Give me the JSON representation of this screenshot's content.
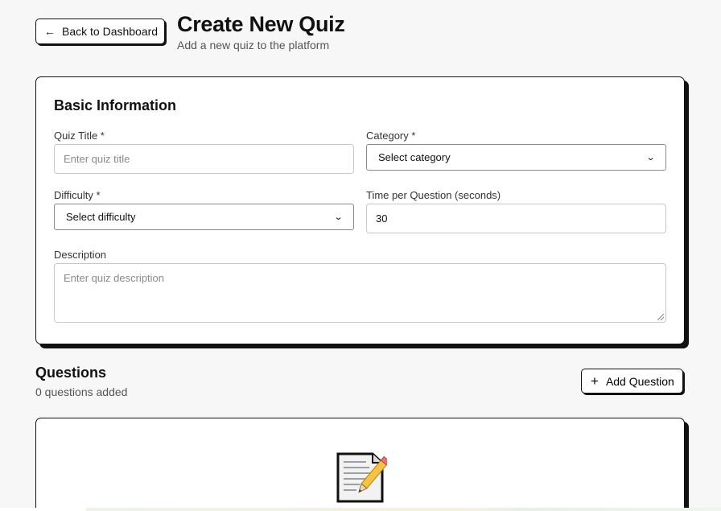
{
  "header": {
    "back_label": "Back to Dashboard",
    "title": "Create New Quiz",
    "subtitle": "Add a new quiz to the platform"
  },
  "basic_info": {
    "title": "Basic Information",
    "quiz_title": {
      "label": "Quiz Title *",
      "value": "",
      "placeholder": "Enter quiz title"
    },
    "category": {
      "label": "Category *",
      "selected": "Select category"
    },
    "difficulty": {
      "label": "Difficulty *",
      "selected": "Select difficulty"
    },
    "time_per_question": {
      "label": "Time per Question (seconds)",
      "value": "30"
    },
    "description": {
      "label": "Description",
      "value": "",
      "placeholder": "Enter quiz description"
    }
  },
  "questions": {
    "title": "Questions",
    "count_text": "0 questions added",
    "add_label": "Add Question",
    "empty_icon": "memo-icon"
  },
  "icons": {
    "back": "arrow-left-icon",
    "add": "plus-icon",
    "select": "chevron-down-icon"
  }
}
